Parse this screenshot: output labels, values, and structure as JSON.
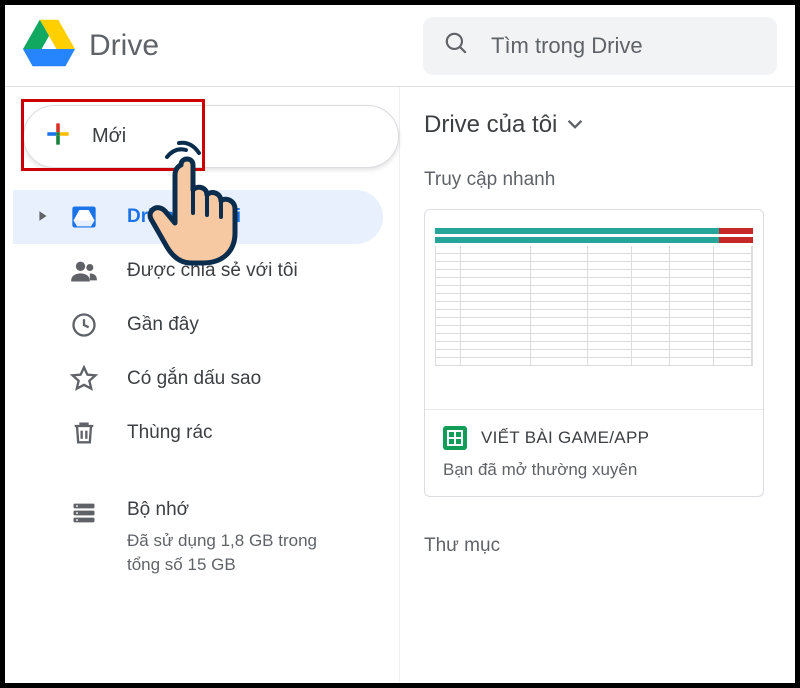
{
  "header": {
    "app_title": "Drive",
    "search_placeholder": "Tìm trong Drive"
  },
  "sidebar": {
    "new_label": "Mới",
    "items": [
      {
        "label": "Drive của tôi",
        "icon": "drive"
      },
      {
        "label": "Được chia sẻ với tôi",
        "icon": "shared"
      },
      {
        "label": "Gần đây",
        "icon": "recent"
      },
      {
        "label": "Có gắn dấu sao",
        "icon": "starred"
      },
      {
        "label": "Thùng rác",
        "icon": "trash"
      }
    ],
    "storage": {
      "label": "Bộ nhớ",
      "sub": "Đã sử dụng 1,8 GB trong tổng số 15 GB"
    }
  },
  "main": {
    "breadcrumb": "Drive của tôi",
    "quick_access_label": "Truy cập nhanh",
    "quick_card": {
      "title": "VIẾT BÀI GAME/APP",
      "sub": "Bạn đã mở thường xuyên"
    },
    "folders_label": "Thư mục"
  }
}
